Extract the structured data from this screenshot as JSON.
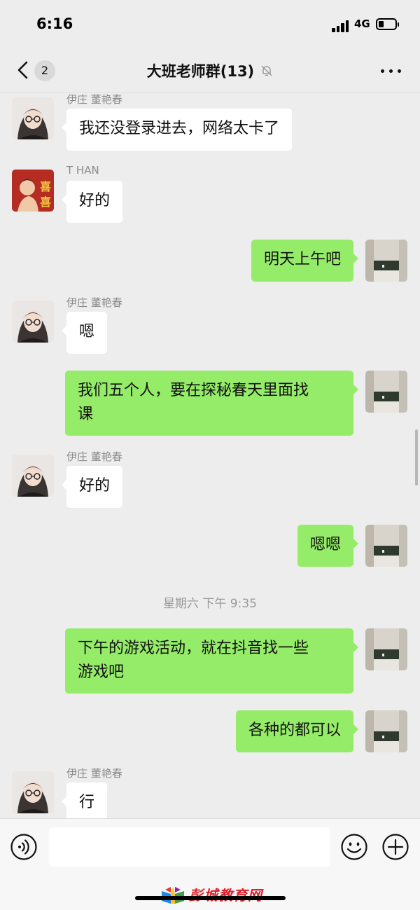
{
  "status_bar": {
    "time": "6:16",
    "network": "4G"
  },
  "header": {
    "back_count": "2",
    "title": "大班老师群(13)"
  },
  "messages": [
    {
      "sender": "伊庄 董艳春",
      "text": "我还没登录进去，网络太卡了"
    },
    {
      "sender": "T HAN",
      "text": "好的"
    },
    {
      "text": "明天上午吧"
    },
    {
      "sender": "伊庄 董艳春",
      "text": "嗯"
    },
    {
      "text_line1": "我们五个人，要在探秘春天里面找",
      "text_line2": "课"
    },
    {
      "sender": "伊庄 董艳春",
      "text": "好的"
    },
    {
      "text": "嗯嗯"
    },
    {
      "timestamp": "星期六 下午 9:35"
    },
    {
      "text_line1": "下午的游戏活动，就在抖音找一些",
      "text_line2": "游戏吧"
    },
    {
      "text": "各种的都可以"
    },
    {
      "sender": "伊庄 董艳春",
      "text": "行"
    }
  ],
  "input_bar": {
    "placeholder": ""
  },
  "watermark": {
    "text": "彭城教育网"
  },
  "icons": [
    "back-icon",
    "mute-icon",
    "more-icon",
    "voice-icon",
    "emoji-icon",
    "plus-icon"
  ],
  "colors": {
    "outgoing_bubble": "#95ec69",
    "incoming_bubble": "#ffffff",
    "background": "#ededed"
  }
}
